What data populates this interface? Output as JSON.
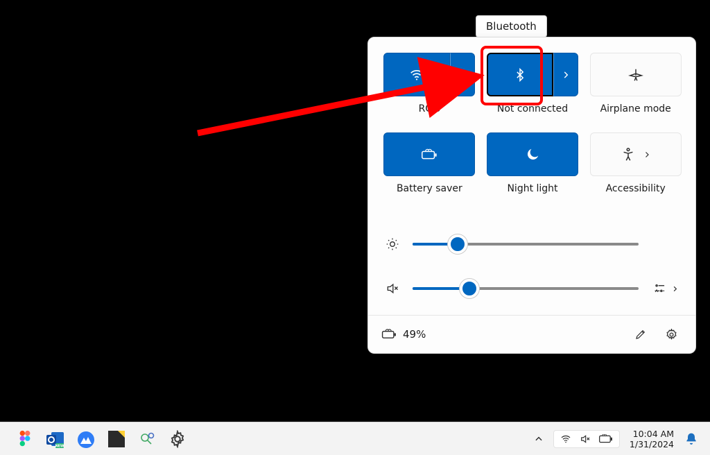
{
  "tooltip": "Bluetooth",
  "tiles": {
    "wifi": {
      "label": "RGG"
    },
    "bluetooth": {
      "label": "Not connected"
    },
    "airplane": {
      "label": "Airplane mode"
    },
    "battery": {
      "label": "Battery saver"
    },
    "nightlight": {
      "label": "Night light"
    },
    "accessibility": {
      "label": "Accessibility"
    }
  },
  "sliders": {
    "brightness_pct": 20,
    "volume_pct": 25
  },
  "footer": {
    "battery_text": "49%"
  },
  "tray": {
    "time": "10:04 AM",
    "date": "1/31/2024"
  },
  "colors": {
    "accent": "#0067c0",
    "annotation": "#ff0000"
  }
}
